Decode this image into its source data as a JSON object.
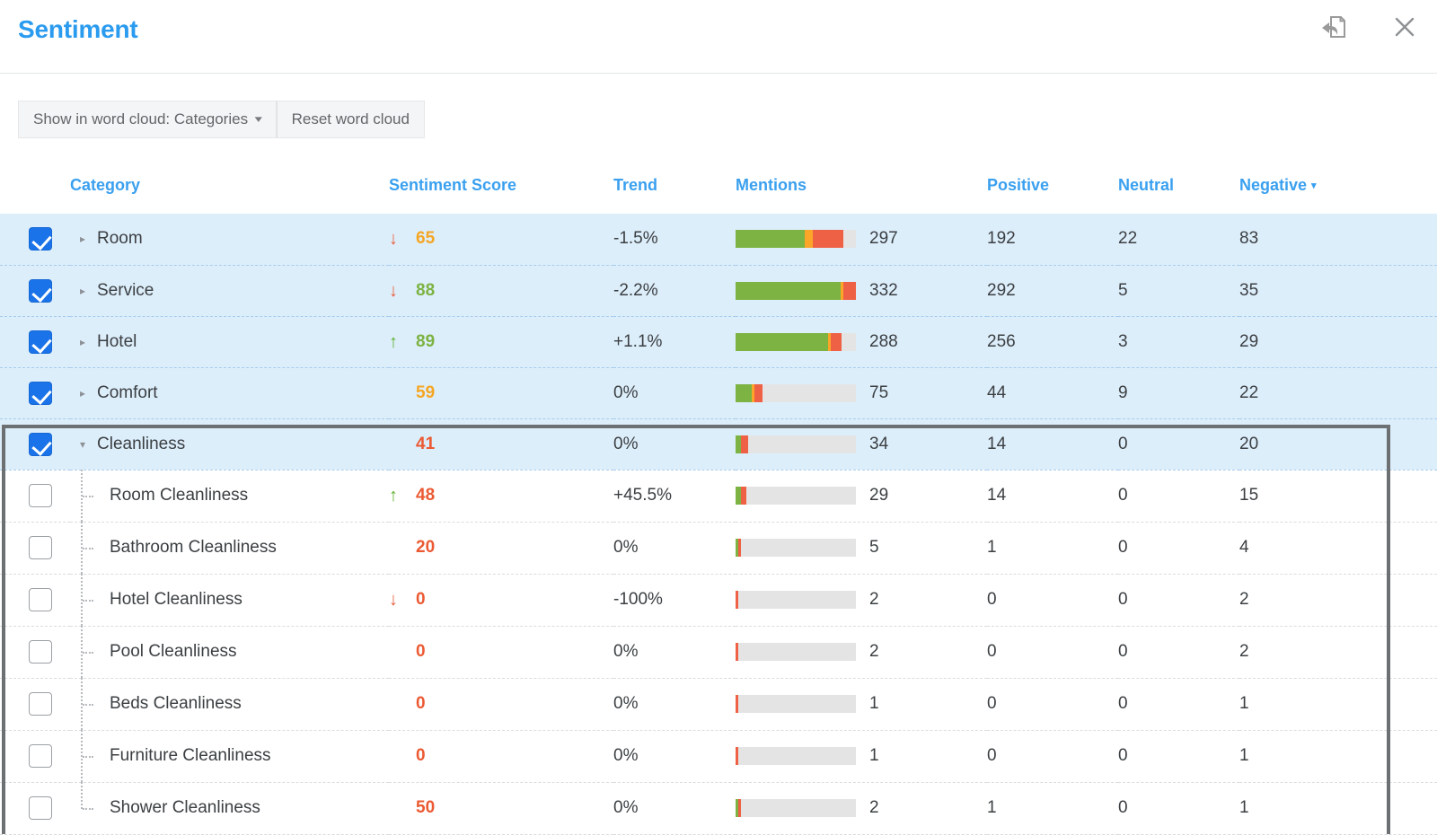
{
  "header": {
    "title": "Sentiment",
    "actions": [
      {
        "name": "revert-page-icon",
        "label": ""
      },
      {
        "name": "close-icon",
        "label": ""
      }
    ]
  },
  "toolbar": {
    "word_cloud_select_label": "Show in word cloud: Categories",
    "word_cloud_caret": "⌄",
    "reset_label": "Reset word cloud"
  },
  "colors": {
    "accent_blue": "#3aa0ef",
    "checkbox_blue": "#1a73e8",
    "selected_row_bg": "#ddeefb",
    "positive_green": "#7cb342",
    "neutral_orange": "#fba529",
    "negative_red": "#ef6145",
    "bar_track": "#e4e4e4",
    "score_green": "#7cb342",
    "score_orange": "#f5a623",
    "score_red": "#eb5a33",
    "frame_gray": "#6d7073"
  },
  "table": {
    "columns": [
      {
        "key": "check",
        "label": ""
      },
      {
        "key": "category",
        "label": "Category"
      },
      {
        "key": "score",
        "label": "Sentiment Score"
      },
      {
        "key": "trend",
        "label": "Trend"
      },
      {
        "key": "mentions",
        "label": "Mentions"
      },
      {
        "key": "positive",
        "label": "Positive"
      },
      {
        "key": "neutral",
        "label": "Neutral"
      },
      {
        "key": "negative",
        "label": "Negative"
      }
    ],
    "sorted_column": "negative",
    "sort_direction": "desc",
    "sort_caret": "▾",
    "bar_max": 332,
    "rows": [
      {
        "category": "Room",
        "level": 0,
        "checked": true,
        "expanded": false,
        "has_children": true,
        "score": "65",
        "score_color": "orange",
        "arrow": "down",
        "trend": "-1.5%",
        "mentions": "297",
        "positive": "192",
        "neutral": "22",
        "negative": "83",
        "bar": {
          "pos": 192,
          "neu": 22,
          "neg": 83
        }
      },
      {
        "category": "Service",
        "level": 0,
        "checked": true,
        "expanded": false,
        "has_children": true,
        "score": "88",
        "score_color": "green",
        "arrow": "down",
        "trend": "-2.2%",
        "mentions": "332",
        "positive": "292",
        "neutral": "5",
        "negative": "35",
        "bar": {
          "pos": 292,
          "neu": 5,
          "neg": 35
        }
      },
      {
        "category": "Hotel",
        "level": 0,
        "checked": true,
        "expanded": false,
        "has_children": true,
        "score": "89",
        "score_color": "green",
        "arrow": "up",
        "trend": "+1.1%",
        "mentions": "288",
        "positive": "256",
        "neutral": "3",
        "negative": "29",
        "bar": {
          "pos": 256,
          "neu": 3,
          "neg": 29
        }
      },
      {
        "category": "Comfort",
        "level": 0,
        "checked": true,
        "expanded": false,
        "has_children": true,
        "score": "59",
        "score_color": "orange",
        "arrow": "none",
        "trend": "0%",
        "mentions": "75",
        "positive": "44",
        "neutral": "9",
        "negative": "22",
        "bar": {
          "pos": 44,
          "neu": 9,
          "neg": 22
        }
      },
      {
        "category": "Cleanliness",
        "level": 0,
        "checked": true,
        "expanded": true,
        "has_children": true,
        "score": "41",
        "score_color": "red",
        "arrow": "none",
        "trend": "0%",
        "mentions": "34",
        "positive": "14",
        "neutral": "0",
        "negative": "20",
        "bar": {
          "pos": 14,
          "neu": 0,
          "neg": 20
        }
      },
      {
        "category": "Room Cleanliness",
        "level": 1,
        "checked": false,
        "expanded": false,
        "has_children": false,
        "score": "48",
        "score_color": "red",
        "arrow": "up",
        "trend": "+45.5%",
        "mentions": "29",
        "positive": "14",
        "neutral": "0",
        "negative": "15",
        "bar": {
          "pos": 14,
          "neu": 0,
          "neg": 15
        }
      },
      {
        "category": "Bathroom Cleanliness",
        "level": 1,
        "checked": false,
        "expanded": false,
        "has_children": false,
        "score": "20",
        "score_color": "red",
        "arrow": "none",
        "trend": "0%",
        "mentions": "5",
        "positive": "1",
        "neutral": "0",
        "negative": "4",
        "bar": {
          "pos": 1,
          "neu": 0,
          "neg": 4
        }
      },
      {
        "category": "Hotel Cleanliness",
        "level": 1,
        "checked": false,
        "expanded": false,
        "has_children": false,
        "score": "0",
        "score_color": "red",
        "arrow": "down",
        "trend": "-100%",
        "mentions": "2",
        "positive": "0",
        "neutral": "0",
        "negative": "2",
        "bar": {
          "pos": 0,
          "neu": 0,
          "neg": 2
        }
      },
      {
        "category": "Pool Cleanliness",
        "level": 1,
        "checked": false,
        "expanded": false,
        "has_children": false,
        "score": "0",
        "score_color": "red",
        "arrow": "none",
        "trend": "0%",
        "mentions": "2",
        "positive": "0",
        "neutral": "0",
        "negative": "2",
        "bar": {
          "pos": 0,
          "neu": 0,
          "neg": 2
        }
      },
      {
        "category": "Beds Cleanliness",
        "level": 1,
        "checked": false,
        "expanded": false,
        "has_children": false,
        "score": "0",
        "score_color": "red",
        "arrow": "none",
        "trend": "0%",
        "mentions": "1",
        "positive": "0",
        "neutral": "0",
        "negative": "1",
        "bar": {
          "pos": 0,
          "neu": 0,
          "neg": 1
        }
      },
      {
        "category": "Furniture Cleanliness",
        "level": 1,
        "checked": false,
        "expanded": false,
        "has_children": false,
        "score": "0",
        "score_color": "red",
        "arrow": "none",
        "trend": "0%",
        "mentions": "1",
        "positive": "0",
        "neutral": "0",
        "negative": "1",
        "bar": {
          "pos": 0,
          "neu": 0,
          "neg": 1
        }
      },
      {
        "category": "Shower Cleanliness",
        "level": 1,
        "checked": false,
        "expanded": false,
        "has_children": false,
        "score": "50",
        "score_color": "red",
        "arrow": "none",
        "trend": "0%",
        "mentions": "2",
        "positive": "1",
        "neutral": "0",
        "negative": "1",
        "bar": {
          "pos": 1,
          "neu": 0,
          "neg": 1
        }
      }
    ]
  }
}
